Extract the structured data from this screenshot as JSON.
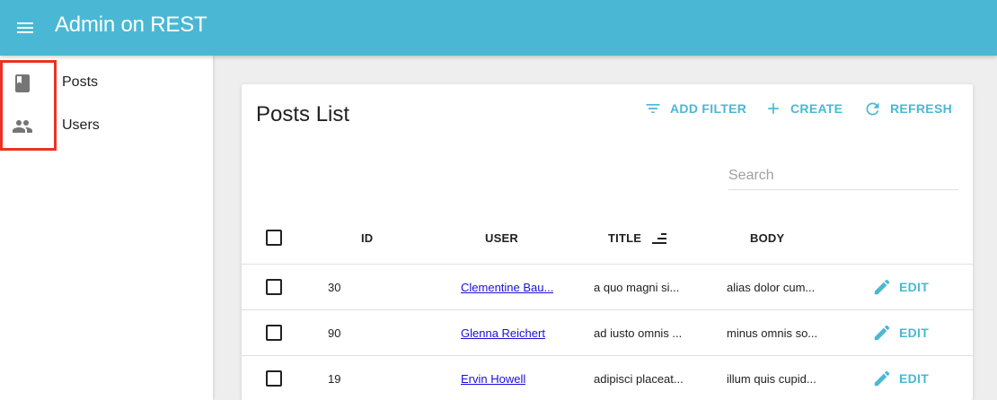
{
  "app": {
    "title": "Admin on REST"
  },
  "sidebar": {
    "items": [
      {
        "label": "Posts",
        "icon": "book-icon"
      },
      {
        "label": "Users",
        "icon": "people-icon"
      }
    ]
  },
  "list": {
    "title": "Posts List",
    "actions": {
      "add_filter": "ADD FILTER",
      "create": "CREATE",
      "refresh": "REFRESH"
    },
    "search_placeholder": "Search",
    "columns": {
      "id": "ID",
      "user": "USER",
      "title": "TITLE",
      "body": "BODY"
    },
    "sort_column": "title",
    "rows": [
      {
        "id": "30",
        "user": "Clementine Bau...",
        "title": "a quo magni si...",
        "body": "alias dolor cum...",
        "edit": "EDIT"
      },
      {
        "id": "90",
        "user": "Glenna Reichert",
        "title": "ad iusto omnis ...",
        "body": "minus omnis so...",
        "edit": "EDIT"
      },
      {
        "id": "19",
        "user": "Ervin Howell",
        "title": "adipisci placeat...",
        "body": "illum quis cupid...",
        "edit": "EDIT"
      }
    ]
  },
  "colors": {
    "primary": "#4ab8d4",
    "link": "#1b0fdb",
    "highlight": "#ea3323"
  }
}
